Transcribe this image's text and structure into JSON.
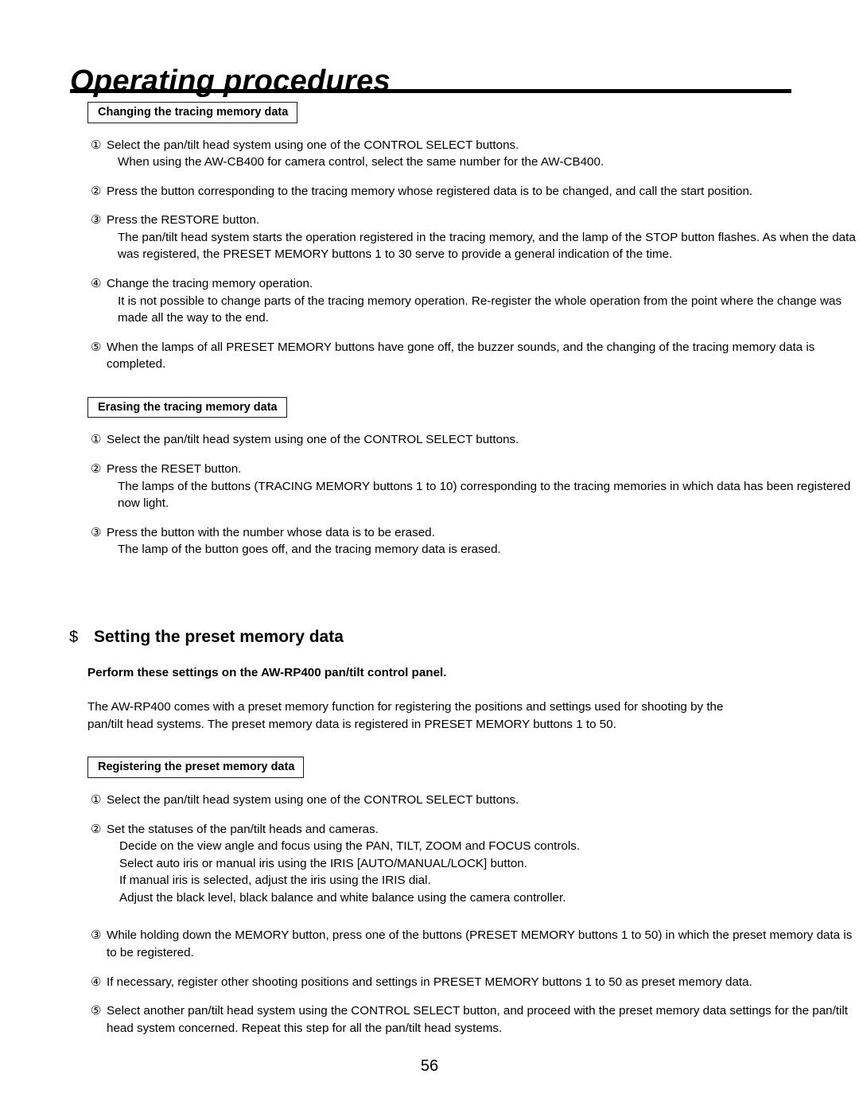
{
  "document": {
    "title": "Operating procedures",
    "page_number": "56"
  },
  "sections": {
    "changing": {
      "heading": "Changing the tracing memory data",
      "steps": [
        {
          "num": "①",
          "lines": [
            "Select the pan/tilt head system using one of the CONTROL SELECT buttons.",
            "When using the AW-CB400 for camera control, select the same number for the AW-CB400."
          ]
        },
        {
          "num": "②",
          "lines": [
            "Press the button corresponding to the tracing memory whose registered data is to be changed, and call the start position."
          ]
        },
        {
          "num": "③",
          "lines": [
            "Press the RESTORE button.",
            "The pan/tilt head system starts the operation registered in the tracing memory, and the lamp of the STOP button flashes. As when the data was registered, the PRESET MEMORY buttons 1 to 30 serve to provide a general indication of the time."
          ]
        },
        {
          "num": "④",
          "lines": [
            "Change the tracing memory operation.",
            "It is not possible to change parts of the tracing memory operation. Re-register the whole operation from the point where the change was made all the way to the end."
          ]
        },
        {
          "num": "⑤",
          "lines": [
            "When the lamps of all PRESET MEMORY buttons have gone off, the buzzer sounds, and the changing of the tracing memory data is completed."
          ]
        }
      ]
    },
    "erasing": {
      "heading": "Erasing the tracing memory data",
      "steps": [
        {
          "num": "①",
          "lines": [
            "Select the pan/tilt head system using one of the CONTROL SELECT buttons."
          ]
        },
        {
          "num": "②",
          "lines": [
            "Press the RESET button.",
            "The lamps of the buttons (TRACING MEMORY buttons 1 to 10) corresponding to the tracing memories in which data has been registered now light."
          ]
        },
        {
          "num": "③",
          "lines": [
            "Press the button with the number whose data is to be erased.",
            "The lamp of the button goes off, and the tracing memory data is erased."
          ]
        }
      ]
    },
    "setting_preset": {
      "marker": "$",
      "heading": "Setting the preset memory data",
      "note": "Perform these settings on the AW-RP400 pan/tilt control panel.",
      "paragraph_line1": "The AW-RP400 comes with a preset memory function for registering the positions and settings used for shooting by the",
      "paragraph_line2": "pan/tilt head systems. The preset memory data is registered in PRESET MEMORY buttons 1 to 50."
    },
    "registering": {
      "heading": "Registering the preset memory data",
      "steps": [
        {
          "num": "①",
          "lines": [
            "Select the pan/tilt head system using one of the CONTROL SELECT buttons."
          ]
        },
        {
          "num": "②",
          "lines": [
            "Set the statuses of the pan/tilt heads and cameras.",
            "Decide on the view angle and focus using the PAN, TILT, ZOOM and FOCUS controls.",
            "Select auto iris or manual iris using the IRIS [AUTO/MANUAL/LOCK] button.",
            "If manual iris is selected, adjust the iris using the IRIS dial.",
            "Adjust the black level, black balance and white balance using the camera controller."
          ]
        },
        {
          "num": "③",
          "lines": [
            "While holding down the MEMORY button, press one of the buttons (PRESET MEMORY buttons 1 to 50) in which the preset memory data is to be registered."
          ]
        },
        {
          "num": "④",
          "lines": [
            "If necessary, register other shooting positions and settings in PRESET MEMORY buttons 1 to 50 as preset memory data."
          ]
        },
        {
          "num": "⑤",
          "lines": [
            "Select another pan/tilt head system using the CONTROL SELECT button, and proceed with the preset memory data settings for the pan/tilt head system concerned. Repeat this step for all the pan/tilt head systems."
          ]
        }
      ]
    }
  }
}
